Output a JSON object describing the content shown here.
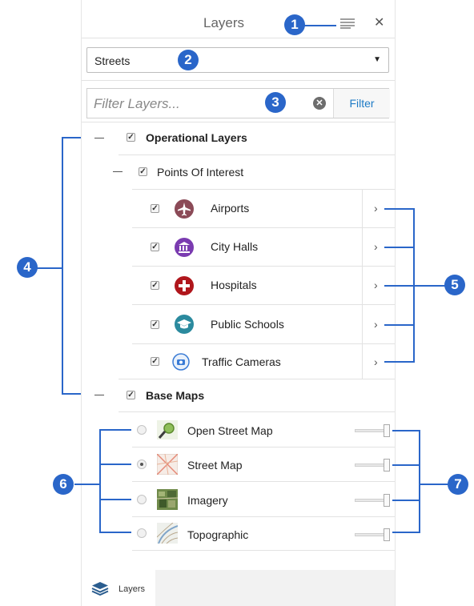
{
  "panel": {
    "title": "Layers",
    "menu_icon": "hamburger-menu-icon",
    "close_icon": "close-icon",
    "close_glyph": "✕"
  },
  "basemap_select": {
    "value": "Streets",
    "arrow": "▼"
  },
  "filter": {
    "placeholder": "Filter Layers...",
    "clear_glyph": "✕",
    "button_label": "Filter"
  },
  "tree": {
    "operational_label": "Operational Layers",
    "points_of_interest_label": "Points Of Interest",
    "layers": [
      {
        "label": "Airports",
        "icon": "airport-icon",
        "color": "#8b4a57",
        "checked": true
      },
      {
        "label": "City Halls",
        "icon": "city-hall-icon",
        "color": "#7a3bb0",
        "checked": true
      },
      {
        "label": "Hospitals",
        "icon": "hospital-icon",
        "color": "#b0161c",
        "checked": true
      },
      {
        "label": "Public Schools",
        "icon": "school-icon",
        "color": "#2b8a9e",
        "checked": true
      },
      {
        "label": "Traffic Cameras",
        "icon": "camera-icon",
        "color": "#3a7bd5",
        "checked": true
      }
    ],
    "base_maps_label": "Base Maps",
    "basemaps": [
      {
        "label": "Open Street Map",
        "icon": "open-street-map-thumbnail",
        "selected": false,
        "opacity": 1.0
      },
      {
        "label": "Street Map",
        "icon": "street-map-thumbnail",
        "selected": true,
        "opacity": 1.0
      },
      {
        "label": "Imagery",
        "icon": "imagery-thumbnail",
        "selected": false,
        "opacity": 1.0
      },
      {
        "label": "Topographic",
        "icon": "topographic-thumbnail",
        "selected": false,
        "opacity": 1.0
      }
    ]
  },
  "footer": {
    "tab_label": "Layers",
    "tab_icon": "layers-stack-icon"
  },
  "callouts": [
    "1",
    "2",
    "3",
    "4",
    "5",
    "6",
    "7"
  ],
  "colors": {
    "callout": "#2a66c9",
    "filter_text": "#1e7bc6"
  }
}
